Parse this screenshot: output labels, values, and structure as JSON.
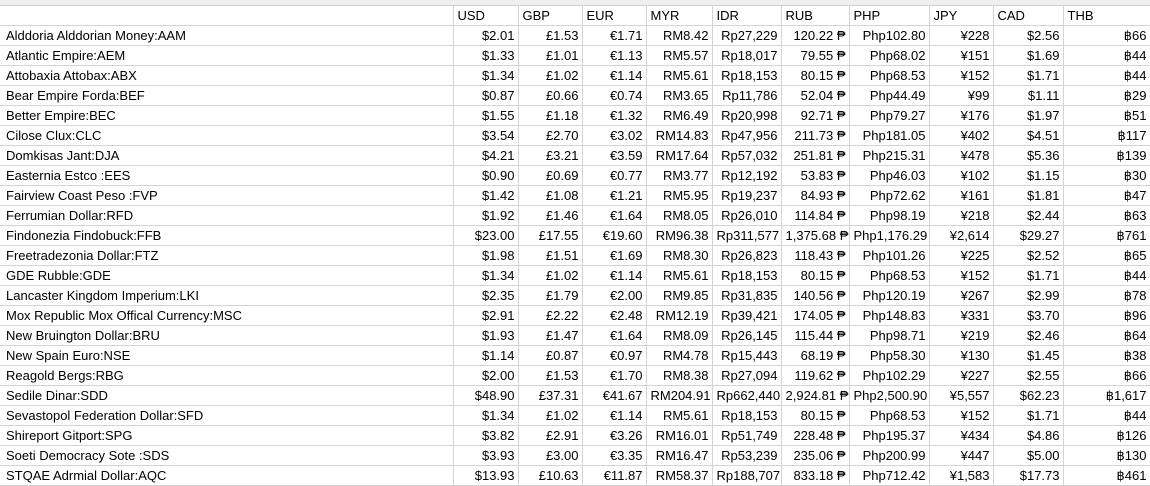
{
  "headers": [
    "",
    "USD",
    "GBP",
    "EUR",
    "MYR",
    "IDR",
    "RUB",
    "PHP",
    "JPY",
    "CAD",
    "THB"
  ],
  "rows": [
    [
      "Alddoria Alddorian Money:AAM",
      "$2.01",
      "£1.53",
      "€1.71",
      "RM8.42",
      "Rp27,229",
      "120.22 ₱",
      "Php102.80",
      "¥228",
      "$2.56",
      "฿66"
    ],
    [
      "Atlantic Empire:AEM",
      "$1.33",
      "£1.01",
      "€1.13",
      "RM5.57",
      "Rp18,017",
      "79.55 ₱",
      "Php68.02",
      "¥151",
      "$1.69",
      "฿44"
    ],
    [
      "Attobaxia Attobax:ABX",
      "$1.34",
      "£1.02",
      "€1.14",
      "RM5.61",
      "Rp18,153",
      "80.15 ₱",
      "Php68.53",
      "¥152",
      "$1.71",
      "฿44"
    ],
    [
      "Bear Empire Forda:BEF",
      "$0.87",
      "£0.66",
      "€0.74",
      "RM3.65",
      "Rp11,786",
      "52.04 ₱",
      "Php44.49",
      "¥99",
      "$1.11",
      "฿29"
    ],
    [
      "Better Empire:BEC",
      "$1.55",
      "£1.18",
      "€1.32",
      "RM6.49",
      "Rp20,998",
      "92.71 ₱",
      "Php79.27",
      "¥176",
      "$1.97",
      "฿51"
    ],
    [
      "Cilose Clux:CLC",
      "$3.54",
      "£2.70",
      "€3.02",
      "RM14.83",
      "Rp47,956",
      "211.73 ₱",
      "Php181.05",
      "¥402",
      "$4.51",
      "฿117"
    ],
    [
      "Domkisas Jant:DJA",
      "$4.21",
      "£3.21",
      "€3.59",
      "RM17.64",
      "Rp57,032",
      "251.81 ₱",
      "Php215.31",
      "¥478",
      "$5.36",
      "฿139"
    ],
    [
      "Easternia Estco :EES",
      "$0.90",
      "£0.69",
      "€0.77",
      "RM3.77",
      "Rp12,192",
      "53.83 ₱",
      "Php46.03",
      "¥102",
      "$1.15",
      "฿30"
    ],
    [
      "Fairview Coast Peso :FVP",
      "$1.42",
      "£1.08",
      "€1.21",
      "RM5.95",
      "Rp19,237",
      "84.93 ₱",
      "Php72.62",
      "¥161",
      "$1.81",
      "฿47"
    ],
    [
      "Ferrumian Dollar:RFD",
      "$1.92",
      "£1.46",
      "€1.64",
      "RM8.05",
      "Rp26,010",
      "114.84 ₱",
      "Php98.19",
      "¥218",
      "$2.44",
      "฿63"
    ],
    [
      "Findonezia Findobuck:FFB",
      "$23.00",
      "£17.55",
      "€19.60",
      "RM96.38",
      "Rp311,577",
      "1,375.68 ₱",
      "Php1,176.29",
      "¥2,614",
      "$29.27",
      "฿761"
    ],
    [
      "Freetradezonia Dollar:FTZ",
      "$1.98",
      "£1.51",
      "€1.69",
      "RM8.30",
      "Rp26,823",
      "118.43 ₱",
      "Php101.26",
      "¥225",
      "$2.52",
      "฿65"
    ],
    [
      "GDE Rubble:GDE",
      "$1.34",
      "£1.02",
      "€1.14",
      "RM5.61",
      "Rp18,153",
      "80.15 ₱",
      "Php68.53",
      "¥152",
      "$1.71",
      "฿44"
    ],
    [
      "Lancaster Kingdom Imperium:LKI",
      "$2.35",
      "£1.79",
      "€2.00",
      "RM9.85",
      "Rp31,835",
      "140.56 ₱",
      "Php120.19",
      "¥267",
      "$2.99",
      "฿78"
    ],
    [
      "Mox Republic Mox Offical Currency:MSC",
      "$2.91",
      "£2.22",
      "€2.48",
      "RM12.19",
      "Rp39,421",
      "174.05 ₱",
      "Php148.83",
      "¥331",
      "$3.70",
      "฿96"
    ],
    [
      "New Bruington Dollar:BRU",
      "$1.93",
      "£1.47",
      "€1.64",
      "RM8.09",
      "Rp26,145",
      "115.44 ₱",
      "Php98.71",
      "¥219",
      "$2.46",
      "฿64"
    ],
    [
      "New Spain Euro:NSE",
      "$1.14",
      "£0.87",
      "€0.97",
      "RM4.78",
      "Rp15,443",
      "68.19 ₱",
      "Php58.30",
      "¥130",
      "$1.45",
      "฿38"
    ],
    [
      "Reagold Bergs:RBG",
      "$2.00",
      "£1.53",
      "€1.70",
      "RM8.38",
      "Rp27,094",
      "119.62 ₱",
      "Php102.29",
      "¥227",
      "$2.55",
      "฿66"
    ],
    [
      "Sedile Dinar:SDD",
      "$48.90",
      "£37.31",
      "€41.67",
      "RM204.91",
      "Rp662,440",
      "2,924.81 ₱",
      "Php2,500.90",
      "¥5,557",
      "$62.23",
      "฿1,617"
    ],
    [
      "Sevastopol Federation Dollar:SFD",
      "$1.34",
      "£1.02",
      "€1.14",
      "RM5.61",
      "Rp18,153",
      "80.15 ₱",
      "Php68.53",
      "¥152",
      "$1.71",
      "฿44"
    ],
    [
      "Shireport Gitport:SPG",
      "$3.82",
      "£2.91",
      "€3.26",
      "RM16.01",
      "Rp51,749",
      "228.48 ₱",
      "Php195.37",
      "¥434",
      "$4.86",
      "฿126"
    ],
    [
      "Soeti Democracy Sote :SDS",
      "$3.93",
      "£3.00",
      "€3.35",
      "RM16.47",
      "Rp53,239",
      "235.06 ₱",
      "Php200.99",
      "¥447",
      "$5.00",
      "฿130"
    ],
    [
      "STQAE Adrmial Dollar:AQC",
      "$13.93",
      "£10.63",
      "€11.87",
      "RM58.37",
      "Rp188,707",
      "833.18 ₱",
      "Php712.42",
      "¥1,583",
      "$17.73",
      "฿461"
    ]
  ]
}
